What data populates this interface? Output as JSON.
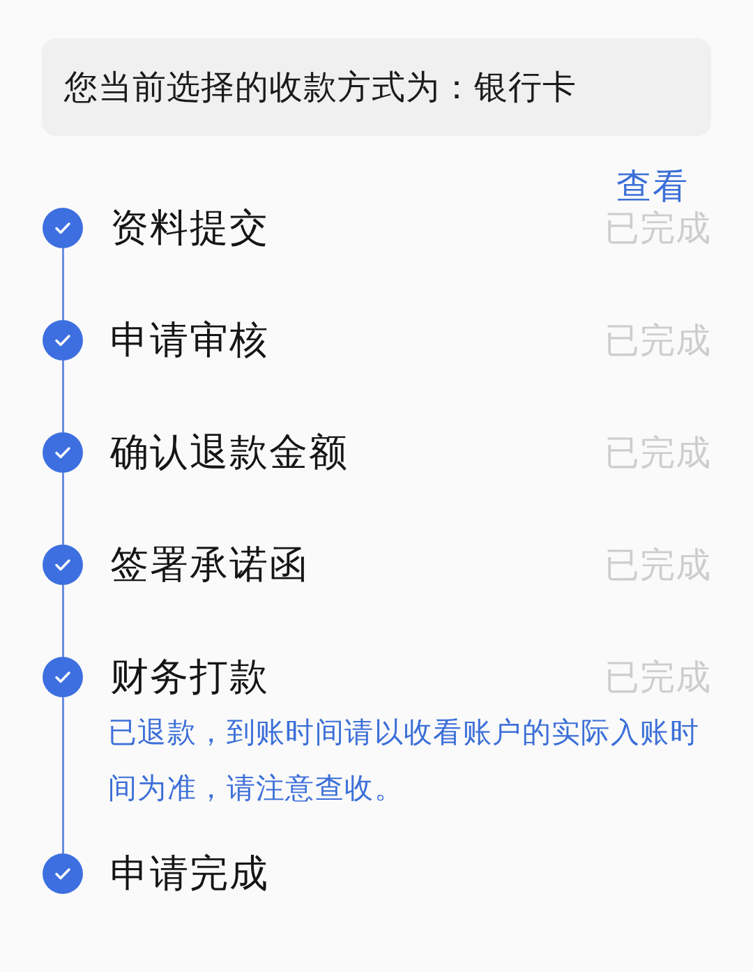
{
  "payment_method": {
    "label": "您当前选择的收款方式为：",
    "value": "银行卡"
  },
  "view_link": "查看",
  "steps": [
    {
      "title": "资料提交",
      "status": "已完成",
      "checked": true
    },
    {
      "title": "申请审核",
      "status": "已完成",
      "checked": true
    },
    {
      "title": "确认退款金额",
      "status": "已完成",
      "checked": true
    },
    {
      "title": "签署承诺函",
      "status": "已完成",
      "checked": true
    },
    {
      "title": "财务打款",
      "status": "已完成",
      "checked": true,
      "note": "已退款，到账时间请以收看账户的实际入账时间为准，请注意查收。"
    },
    {
      "title": "申请完成",
      "checked": true
    }
  ]
}
